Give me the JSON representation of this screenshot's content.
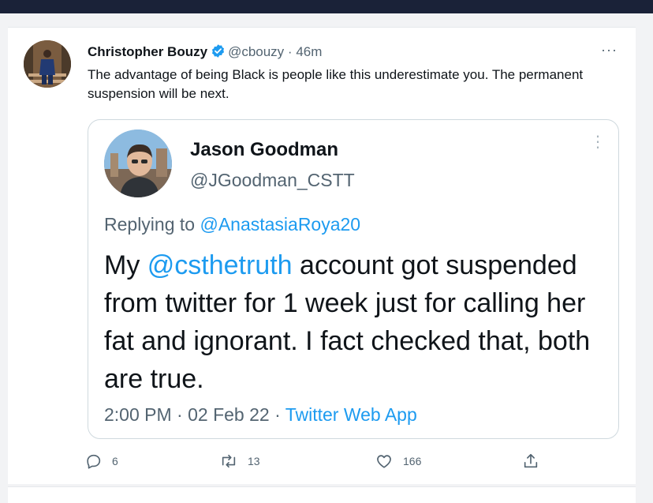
{
  "tweet": {
    "author_name": "Christopher Bouzy",
    "author_handle": "@cbouzy",
    "separator": "·",
    "time": "46m",
    "text": "The advantage of being Black is people like this underestimate you. The permanent suspension will be next.",
    "more_label": "···"
  },
  "quoted": {
    "author_name": "Jason Goodman",
    "author_handle": "@JGoodman_CSTT",
    "more_label": "⋮",
    "replying_prefix": "Replying to",
    "replying_handle": "@AnastasiaRoya20",
    "text_mention": "@csthetruth",
    "text_before": "My ",
    "text_after": " account got suspended from twitter for 1 week just for calling her fat and ignorant.  I fact checked that, both are true.",
    "timestamp": "2:00 PM · 02 Feb 22 · ",
    "source": "Twitter Web App"
  },
  "actions": {
    "reply_count": "6",
    "retweet_count": "13",
    "like_count": "166"
  },
  "colors": {
    "accent": "#1d9bf0",
    "muted": "#536471",
    "verified": "#1d9bf0",
    "topbar": "#1a2238"
  },
  "icons": [
    "verified-badge-icon",
    "more-icon",
    "reply-icon",
    "retweet-icon",
    "like-icon",
    "share-icon"
  ]
}
